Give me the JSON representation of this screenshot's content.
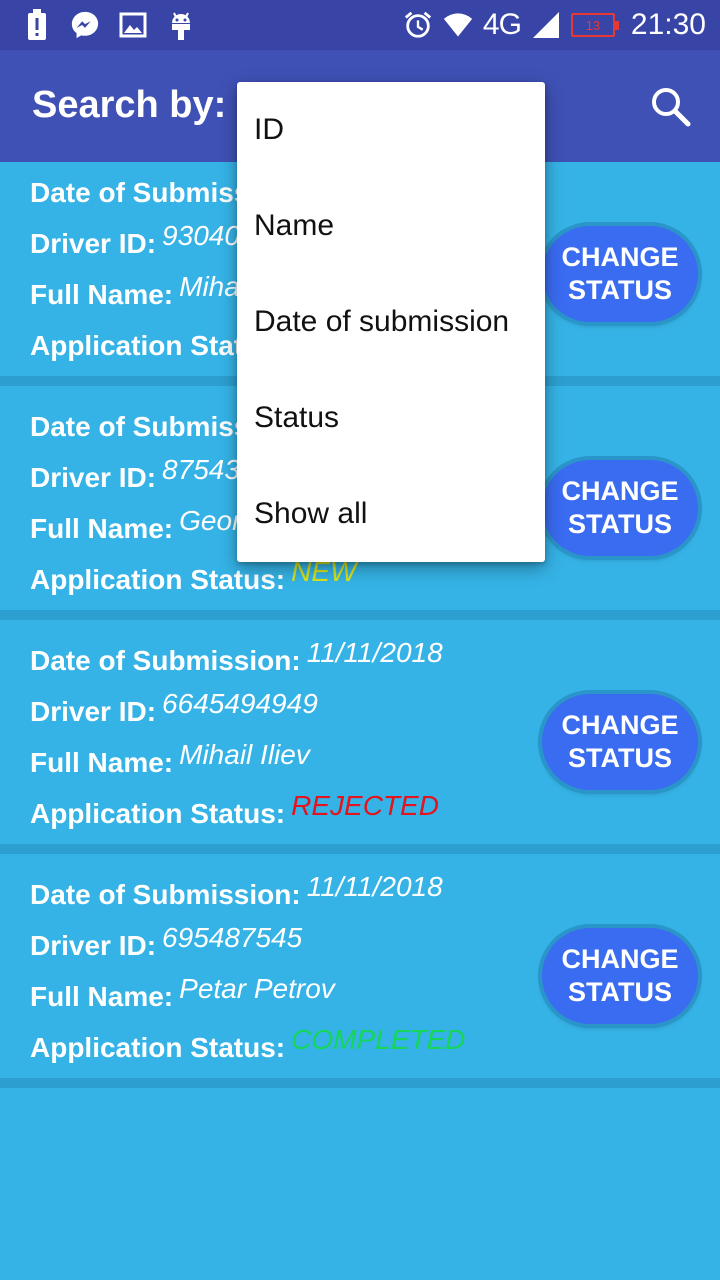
{
  "status_bar": {
    "network": "4G",
    "battery": "13",
    "time": "21:30",
    "icons": [
      "battery-alert-icon",
      "messenger-icon",
      "image-icon",
      "android-icon",
      "alarm-icon",
      "wifi-icon",
      "signal-icon"
    ]
  },
  "toolbar": {
    "title": "Search by:",
    "search_icon": "search-icon"
  },
  "labels": {
    "date": "Date of Submission:",
    "driver_id": "Driver ID:",
    "full_name": "Full Name:",
    "status": "Application Status:",
    "change_line1": "CHANGE",
    "change_line2": "STATUS"
  },
  "applications": [
    {
      "date": "",
      "driver_id": "93040",
      "full_name": "Miha",
      "status": "",
      "status_color": "#ffffff"
    },
    {
      "date": "",
      "driver_id": "87543",
      "full_name": "Geor",
      "status": "NEW",
      "status_color": "#d7e31e"
    },
    {
      "date": "11/11/2018",
      "driver_id": "6645494949",
      "full_name": "Mihail Iliev",
      "status": "REJECTED",
      "status_color": "#e3141e"
    },
    {
      "date": "11/11/2018",
      "driver_id": "695487545",
      "full_name": "Petar Petrov",
      "status": "COMPLETED",
      "status_color": "#15d65b"
    }
  ],
  "menu": {
    "items": [
      "ID",
      "Name",
      "Date of submission",
      "Status",
      "Show all"
    ]
  },
  "colors": {
    "status_bar": "#3845a6",
    "toolbar": "#3f51b5",
    "background": "#35b3e6",
    "button": "#3a6cf2"
  }
}
